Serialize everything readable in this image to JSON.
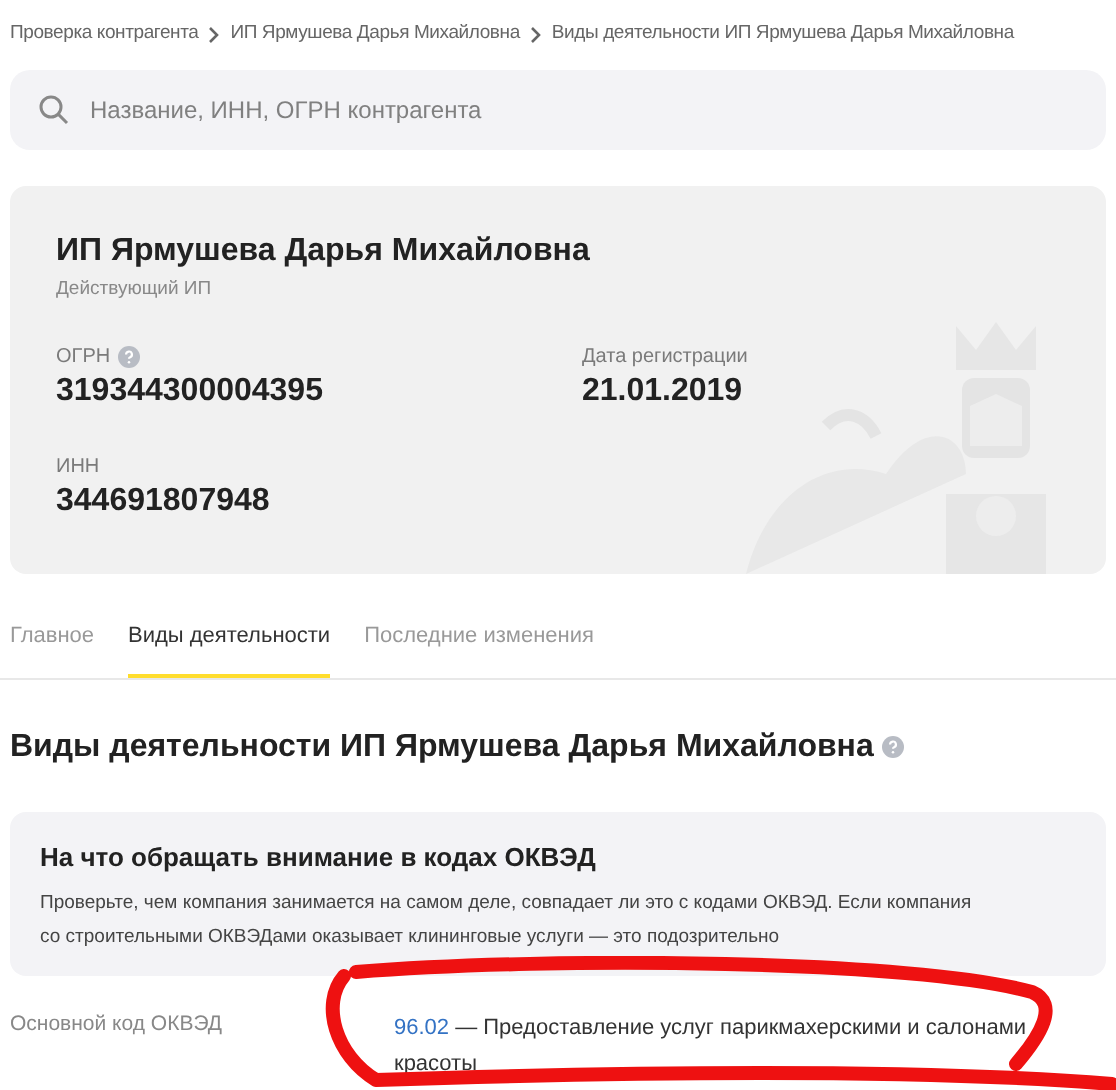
{
  "breadcrumbs": [
    "Проверка контрагента",
    "ИП Ярмушева Дарья Михайловна",
    "Виды деятельности ИП Ярмушева Дарья Михайловна"
  ],
  "search": {
    "placeholder": "Название, ИНН, ОГРН контрагента"
  },
  "company": {
    "name": "ИП Ярмушева Дарья Михайловна",
    "status": "Действующий ИП",
    "fields": [
      {
        "label": "ОГРН",
        "value": "319344300004395",
        "help": true
      },
      {
        "label": "Дата регистрации",
        "value": "21.01.2019",
        "help": false
      },
      {
        "label": "ИНН",
        "value": "344691807948",
        "help": false
      }
    ]
  },
  "tabs": [
    {
      "label": "Главное",
      "selected": false
    },
    {
      "label": "Виды деятельности",
      "selected": true
    },
    {
      "label": "Последние изменения",
      "selected": false
    }
  ],
  "heading": "Виды деятельности ИП Ярмушева Дарья Михайловна",
  "notice": {
    "title": "На что обращать внимание в кодах ОКВЭД",
    "text": "Проверьте, чем компания занимается на самом деле, совпадает ли это с кодами ОКВЭД. Если компания со строительными ОКВЭДами оказывает клининговые услуги — это подозрительно"
  },
  "main_okved": {
    "label": "Основной код ОКВЭД",
    "code": "96.02",
    "description": "— Предоставление услуг парикмахерскими и салонами красоты"
  }
}
